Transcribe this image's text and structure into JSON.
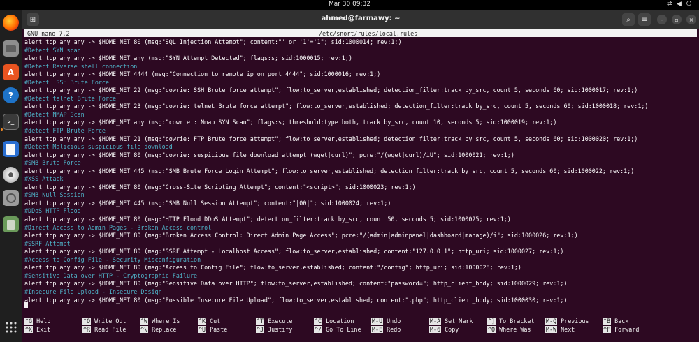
{
  "topbar": {
    "clock": "Mar 30  09:32"
  },
  "dock": {
    "apps": [
      {
        "name": "Firefox",
        "icon": "firefox-icon"
      },
      {
        "name": "Files",
        "icon": "files-icon"
      },
      {
        "name": "App Center",
        "icon": "app-center-icon"
      },
      {
        "name": "Help",
        "icon": "help-icon"
      },
      {
        "name": "Terminal",
        "icon": "terminal-icon"
      },
      {
        "name": "Text Editor",
        "icon": "text-editor-icon"
      },
      {
        "name": "Disc",
        "icon": "disc-icon"
      },
      {
        "name": "Disks",
        "icon": "disks-icon"
      },
      {
        "name": "Trash",
        "icon": "trash-icon"
      },
      {
        "name": "Show Apps",
        "icon": "apps-grid-icon"
      }
    ],
    "help_glyph": "?",
    "appcenter_glyph": "A"
  },
  "window": {
    "title": "ahmed@farmawy: ~",
    "new_tab_glyph": "⊞",
    "search_glyph": "⌕",
    "menu_glyph": "≡",
    "minimize_glyph": "–",
    "restore_glyph": "▫",
    "close_glyph": "×"
  },
  "nano": {
    "version": "  GNU nano 7.2",
    "file": "/etc/snort/rules/local.rules",
    "lines": [
      {
        "text": "alert tcp any any -> $HOME_NET 80 (msg:\"SQL Injection Attempt\"; content:\"' or '1'='1\"; sid:1000014; rev:1;)",
        "type": "rule"
      },
      {
        "text": "#Detect SYN scan",
        "type": "comment"
      },
      {
        "text": "alert tcp any any -> $HOME_NET any (msg:\"SYN Attempt Detected\"; flags:s; sid:1000015; rev:1;)",
        "type": "rule"
      },
      {
        "text": "#Detect Reverse shell connection",
        "type": "comment"
      },
      {
        "text": "alert tcp any any -> $HOME_NET 4444 (msg:\"Connection to remote ip on port 4444\"; sid:1000016; rev:1;)",
        "type": "rule"
      },
      {
        "text": "#Detect  SSH Brute Force",
        "type": "comment"
      },
      {
        "text": "alert tcp any any -> $HOME_NET 22 (msg:\"cowrie: SSH Brute force attempt\"; flow:to_server,established; detection_filter:track by_src, count 5, seconds 60; sid:1000017; rev:1;)",
        "type": "rule"
      },
      {
        "text": "#Detect telnet Brute Force",
        "type": "comment"
      },
      {
        "text": "alert tcp any any -> $HOME_NET 23 (msg:\"cowrie: telnet Brute force attempt\"; flow:to_server,established; detection_filter:track by_src, count 5, seconds 60; sid:1000018; rev:1;)",
        "type": "rule"
      },
      {
        "text": "#Detect NMAP Scan",
        "type": "comment"
      },
      {
        "text": "alert tcp any any -> $HOME_NET any (msg:\"cowrie : Nmap SYN Scan\"; flags:s; threshold:type both, track by_src, count 10, seconds 5; sid:1000019; rev:1;)",
        "type": "rule"
      },
      {
        "text": "#detect FTP Brute Force",
        "type": "comment"
      },
      {
        "text": "alert tcp any any -> $HOME_NET 21 (msg:\"cowrie: FTP Brute force attempt\"; flow:to_server,established; detection_filter:track by_src, count 5, seconds 60; sid:1000020; rev:1;)",
        "type": "rule"
      },
      {
        "text": "#Detect Malicious suspicious file download",
        "type": "comment"
      },
      {
        "text": "alert tcp any any -> $HOME_NET 80 (msg:\"cowrie: suspicious file download attempt (wget|curl)\"; pcre:\"/(wget|curl)/iU\"; sid:1000021; rev:1;)",
        "type": "rule"
      },
      {
        "text": "#SMB Brute Force",
        "type": "comment"
      },
      {
        "text": "alert tcp any any -> $HOME_NET 445 (msg:\"SMB Brute Force Login Attempt\"; flow:to_server,established; detection_filter:track by_src, count 5, seconds 60; sid:1000022; rev:1;)",
        "type": "rule"
      },
      {
        "text": "#XSS Attack",
        "type": "comment"
      },
      {
        "text": "alert tcp any any -> $HOME_NET 80 (msg:\"Cross-Site Scripting Attempt\"; content:\"<script>\"; sid:1000023; rev:1;)",
        "type": "rule"
      },
      {
        "text": "#SMB Null Session",
        "type": "comment"
      },
      {
        "text": "alert tcp any any -> $HOME_NET 445 (msg:\"SMB Null Session Attempt\"; content:\"|00|\"; sid:1000024; rev:1;)",
        "type": "rule"
      },
      {
        "text": "#DDoS HTTP Flood",
        "type": "comment"
      },
      {
        "text": "alert tcp any any -> $HOME_NET 80 (msg:\"HTTP Flood DDoS Attempt\"; detection_filter:track by_src, count 50, seconds 5; sid:1000025; rev:1;)",
        "type": "rule"
      },
      {
        "text": "#Direct Access to Admin Pages - Broken Access control",
        "type": "comment"
      },
      {
        "text": "alert tcp any any -> $HOME_NET 80 (msg:\"Broken Access Control: Direct Admin Page Access\"; pcre:\"/(admin|adminpanel|dashboard|manage)/i\"; sid:1000026; rev:1;)",
        "type": "rule"
      },
      {
        "text": "#SSRF Attempt",
        "type": "comment"
      },
      {
        "text": "alert tcp any any -> $HOME_NET 80 (msg:\"SSRF Attempt - Localhost Access\"; flow:to_server,established; content:\"127.0.0.1\"; http_uri; sid:1000027; rev:1;)",
        "type": "rule"
      },
      {
        "text": "#Access to Config File - Security Misconfiguration",
        "type": "comment"
      },
      {
        "text": "alert tcp any any -> $HOME_NET 80 (msg:\"Access to Config File\"; flow:to_server,established; content:\"/config\"; http_uri; sid:1000028; rev:1;)",
        "type": "rule"
      },
      {
        "text": "#Sensitive Data over HTTP - Cryptographic Failure",
        "type": "comment"
      },
      {
        "text": "alert tcp any any -> $HOME_NET 80 (msg:\"Sensitive Data over HTTP\"; flow:to_server,established; content:\"password=\"; http_client_body; sid:1000029; rev:1;)",
        "type": "rule"
      },
      {
        "text": "#Insecure File Upload - Insecure Design",
        "type": "comment"
      },
      {
        "text": "alert tcp any any -> $HOME_NET 80 (msg:\"Possible Insecure File Upload\"; flow:to_server,established; content:\".php\"; http_client_body; sid:1000030; rev:1;)",
        "type": "rule"
      }
    ],
    "shortcuts": [
      {
        "key": "^G",
        "label": "Help"
      },
      {
        "key": "^X",
        "label": "Exit"
      },
      {
        "key": "^O",
        "label": "Write Out"
      },
      {
        "key": "^R",
        "label": "Read File"
      },
      {
        "key": "^W",
        "label": "Where Is"
      },
      {
        "key": "^\\",
        "label": "Replace"
      },
      {
        "key": "^K",
        "label": "Cut"
      },
      {
        "key": "^U",
        "label": "Paste"
      },
      {
        "key": "^T",
        "label": "Execute"
      },
      {
        "key": "^J",
        "label": "Justify"
      },
      {
        "key": "^C",
        "label": "Location"
      },
      {
        "key": "^/",
        "label": "Go To Line"
      },
      {
        "key": "M-U",
        "label": "Undo"
      },
      {
        "key": "M-E",
        "label": "Redo"
      },
      {
        "key": "M-A",
        "label": "Set Mark"
      },
      {
        "key": "M-6",
        "label": "Copy"
      },
      {
        "key": "^]",
        "label": "To Bracket"
      },
      {
        "key": "^Q",
        "label": "Where Was"
      },
      {
        "key": "M-Q",
        "label": "Previous"
      },
      {
        "key": "M-W",
        "label": "Next"
      },
      {
        "key": "^B",
        "label": "Back"
      },
      {
        "key": "^F",
        "label": "Forward"
      }
    ]
  },
  "colors": {
    "terminal_bg": "#2d0922",
    "comment": "#4fb3c9",
    "text": "#ffffff",
    "dock_bg": "#1f1f1f"
  }
}
